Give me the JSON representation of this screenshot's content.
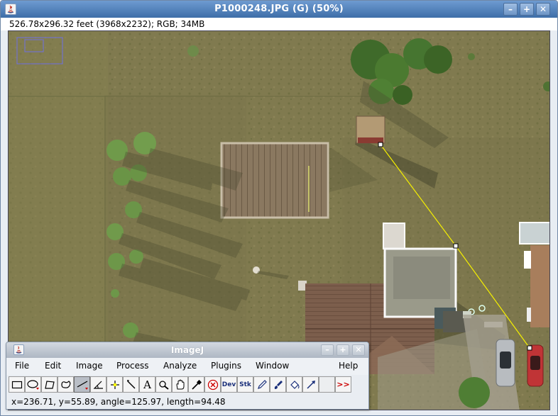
{
  "image_window": {
    "title": "P1000248.JPG (G) (50%)",
    "info": "526.78x296.32 feet (3968x2232); RGB; 34MB",
    "buttons": {
      "minimize": "–",
      "maximize": "+",
      "close": "✕"
    }
  },
  "measurement_line": {
    "color": "#f5f000",
    "description": "straight line selection with handles"
  },
  "imagej_window": {
    "title": "ImageJ",
    "buttons": {
      "minimize": "–",
      "maximize": "+",
      "close": "✕"
    },
    "menu": [
      "File",
      "Edit",
      "Image",
      "Process",
      "Analyze",
      "Plugins",
      "Window",
      "Help"
    ],
    "tools": [
      {
        "name": "rectangle-tool-icon"
      },
      {
        "name": "oval-tool-icon"
      },
      {
        "name": "polygon-tool-icon"
      },
      {
        "name": "freehand-tool-icon"
      },
      {
        "name": "straight-line-tool-icon",
        "selected": true
      },
      {
        "name": "angle-tool-icon"
      },
      {
        "name": "point-tool-icon"
      },
      {
        "name": "wand-tool-icon"
      },
      {
        "name": "text-tool-icon",
        "label": "A"
      },
      {
        "name": "magnifier-tool-icon"
      },
      {
        "name": "hand-tool-icon"
      },
      {
        "name": "dropper-tool-icon"
      },
      {
        "name": "x-tool-icon"
      },
      {
        "name": "dev-menu-icon",
        "label": "Dev"
      },
      {
        "name": "stk-menu-icon",
        "label": "Stk"
      },
      {
        "name": "pencil-tool-icon"
      },
      {
        "name": "brush-tool-icon"
      },
      {
        "name": "flood-fill-tool-icon"
      },
      {
        "name": "arrow-tool-icon"
      },
      {
        "name": "blank-slot"
      },
      {
        "name": "more-tools-icon",
        "label": ">>"
      }
    ],
    "status": "x=236.71, y=55.89, angle=125.97, length=94.48"
  },
  "colors": {
    "accent_title": "#4f80bd",
    "selected_tool": "#b9bec6",
    "grass": "#7f7a4e"
  }
}
